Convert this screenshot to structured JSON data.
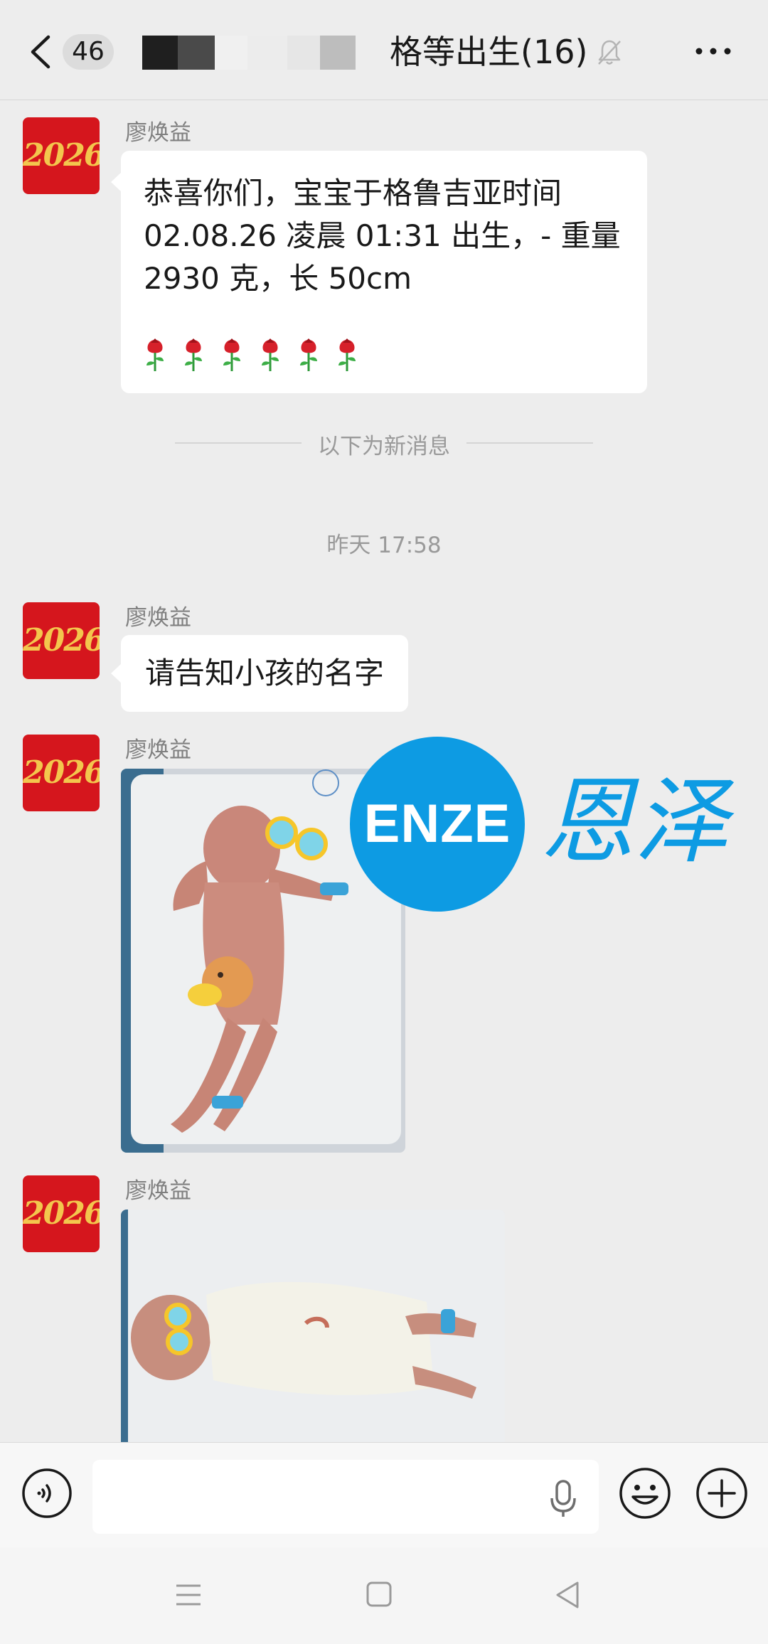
{
  "header": {
    "unread_count": "46",
    "title": "格等出生(16)",
    "title_prefix_dot": "."
  },
  "messages": [
    {
      "sender": "廖焕益",
      "avatar_text": "2026",
      "text": "恭喜你们，宝宝于格鲁吉亚时间\n02.08.26 凌晨 01:31 出生，- 重量\n2930 克，长 50cm",
      "emoji": "🌹🌹🌹🌹🌹🌹"
    },
    {
      "sender": "廖焕益",
      "avatar_text": "2026",
      "text": "请告知小孩的名字"
    },
    {
      "sender": "廖焕益",
      "avatar_text": "2026"
    },
    {
      "sender": "廖焕益",
      "avatar_text": "2026"
    }
  ],
  "divider": {
    "label": "以下为新消息"
  },
  "timestamp": {
    "label": "昨天 17:58"
  },
  "watermark": {
    "latin": "ENZE",
    "chinese": "恩泽"
  },
  "input": {
    "placeholder": ""
  },
  "colors": {
    "background": "#ededed",
    "bubble": "#ffffff",
    "avatar": "#d5161d",
    "watermark": "#0d9be3"
  }
}
